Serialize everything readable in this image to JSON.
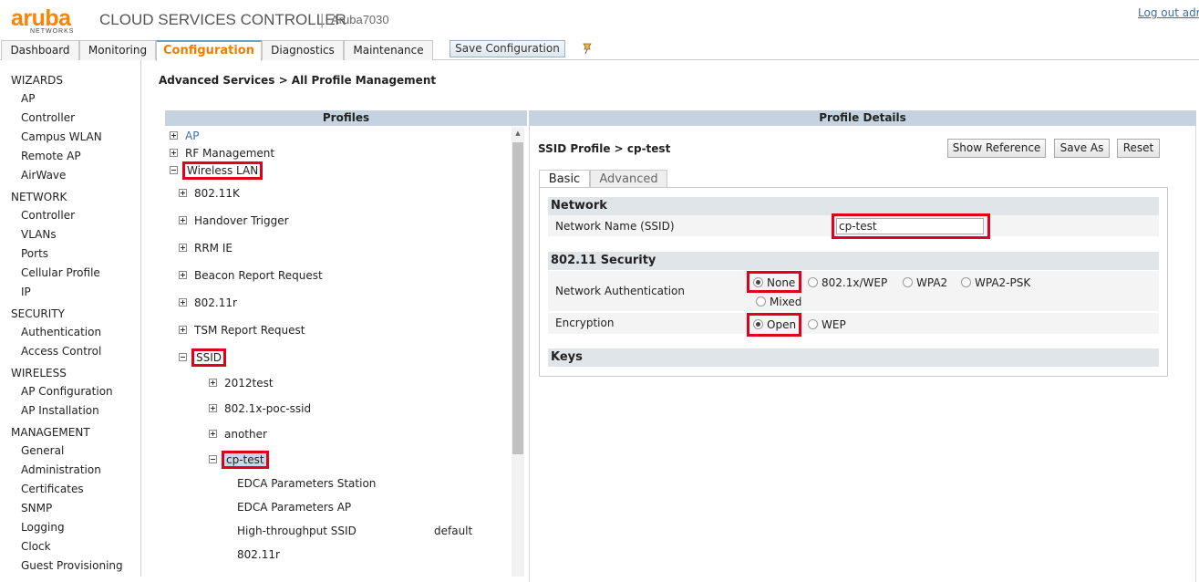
{
  "header": {
    "logo_text": "aruba",
    "logo_subtext": "NETWORKS",
    "product": "CLOUD SERVICES CONTROLLER",
    "separator": "|",
    "device": "Aruba7030",
    "logout": "Log out adr"
  },
  "nav": {
    "tabs": [
      "Dashboard",
      "Monitoring",
      "Configuration",
      "Diagnostics",
      "Maintenance"
    ],
    "active_tab": "Configuration",
    "save_config": "Save Configuration"
  },
  "sidebar": {
    "sections": [
      {
        "title": "WIZARDS",
        "items": [
          "AP",
          "Controller",
          "Campus WLAN",
          "Remote AP",
          "AirWave"
        ]
      },
      {
        "title": "NETWORK",
        "items": [
          "Controller",
          "VLANs",
          "Ports",
          "Cellular Profile",
          "IP"
        ]
      },
      {
        "title": "SECURITY",
        "items": [
          "Authentication",
          "Access Control"
        ]
      },
      {
        "title": "WIRELESS",
        "items": [
          "AP Configuration",
          "AP Installation"
        ]
      },
      {
        "title": "MANAGEMENT",
        "items": [
          "General",
          "Administration",
          "Certificates",
          "SNMP",
          "Logging",
          "Clock",
          "Guest Provisioning"
        ]
      }
    ]
  },
  "breadcrumb": "Advanced Services > All Profile Management",
  "profiles": {
    "header": "Profiles",
    "tree": {
      "ap": "AP",
      "rf_management": "RF Management",
      "wireless_lan": "Wireless LAN",
      "wlan_children": [
        "802.11K",
        "Handover Trigger",
        "RRM IE",
        "Beacon Report Request",
        "802.11r",
        "TSM Report Request"
      ],
      "ssid": "SSID",
      "ssid_children": [
        "2012test",
        "802.1x-poc-ssid",
        "another"
      ],
      "cp_test": "cp-test",
      "cp_test_children": [
        "EDCA Parameters Station",
        "EDCA Parameters AP",
        "High-throughput SSID",
        "802.11r"
      ],
      "ht_value": "default"
    }
  },
  "details": {
    "header": "Profile Details",
    "title": "SSID Profile > cp-test",
    "buttons": {
      "show_reference": "Show Reference",
      "save_as": "Save As",
      "reset": "Reset"
    },
    "tabs": {
      "basic": "Basic",
      "advanced": "Advanced"
    },
    "network": {
      "section": "Network",
      "ssid_label": "Network Name (SSID)",
      "ssid_value": "cp-test"
    },
    "security": {
      "section": "802.11 Security",
      "auth_label": "Network Authentication",
      "auth_options": [
        "None",
        "802.1x/WEP",
        "WPA2",
        "WPA2-PSK",
        "Mixed"
      ],
      "auth_selected": "None",
      "enc_label": "Encryption",
      "enc_options": [
        "Open",
        "WEP"
      ],
      "enc_selected": "Open"
    },
    "keys_section": "Keys"
  }
}
